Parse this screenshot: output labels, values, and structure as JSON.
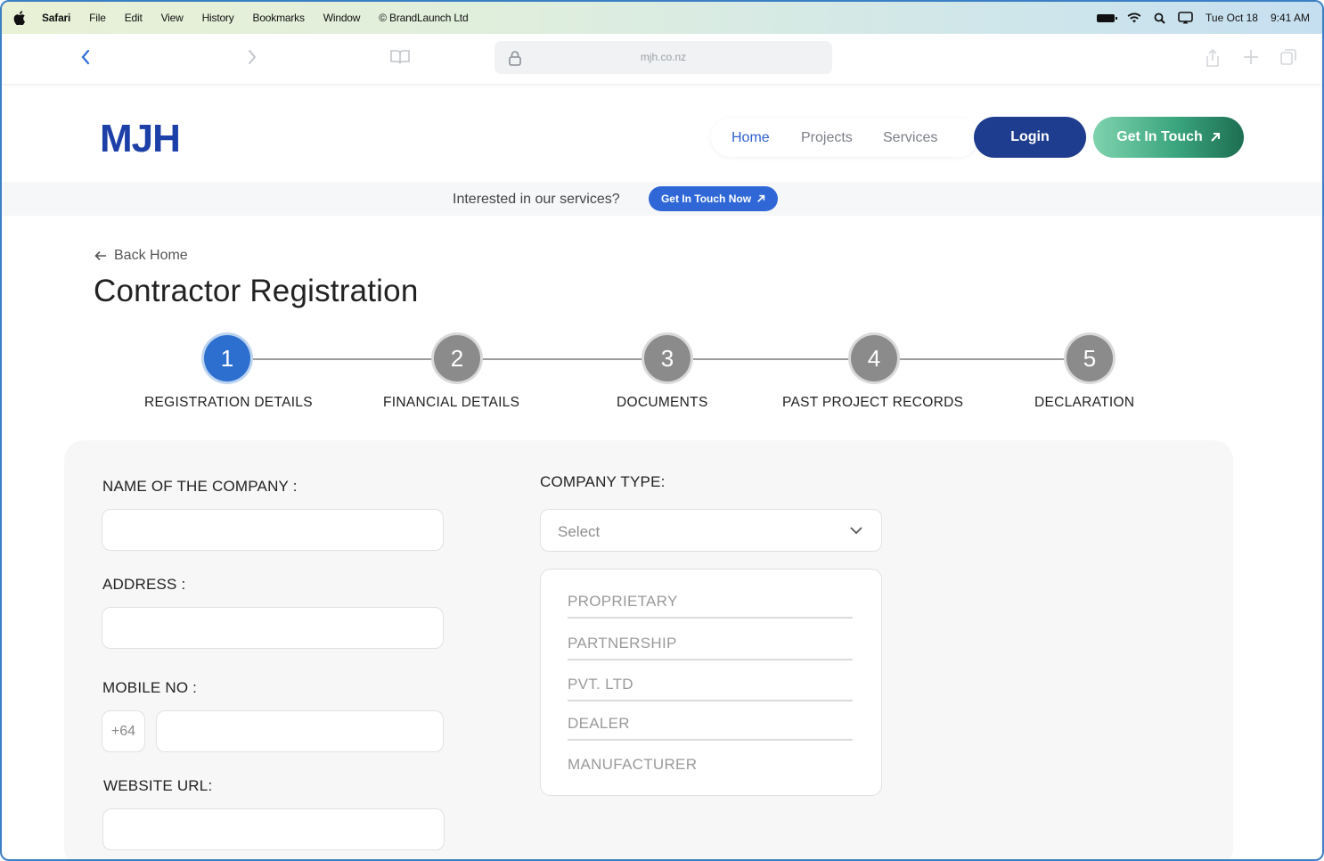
{
  "menubar": {
    "items": [
      "Safari",
      "File",
      "Edit",
      "View",
      "History",
      "Bookmarks",
      "Window",
      "© BrandLaunch Ltd"
    ],
    "date": "Tue Oct 18",
    "time": "9:41 AM"
  },
  "browser": {
    "url": "mjh.co.nz"
  },
  "header": {
    "logo_text": "MJH",
    "nav": [
      {
        "label": "Home",
        "active": true
      },
      {
        "label": "Projects",
        "active": false
      },
      {
        "label": "Services",
        "active": false
      }
    ],
    "login_label": "Login",
    "contact_label": "Get In Touch"
  },
  "banner": {
    "text": "Interested in our services?",
    "button_label": "Get In Touch Now"
  },
  "page": {
    "back_label": "Back Home",
    "title": "Contractor Registration"
  },
  "steps": [
    {
      "number": "1",
      "label": "REGISTRATION DETAILS",
      "active": true
    },
    {
      "number": "2",
      "label": "FINANCIAL DETAILS",
      "active": false
    },
    {
      "number": "3",
      "label": "DOCUMENTS",
      "active": false
    },
    {
      "number": "4",
      "label": "PAST PROJECT RECORDS",
      "active": false
    },
    {
      "number": "5",
      "label": "DECLARATION",
      "active": false
    }
  ],
  "form": {
    "company_name_label": "NAME OF THE COMPANY :",
    "company_name_value": "",
    "address_label": "ADDRESS :",
    "address_value": "",
    "mobile_label": "MOBILE NO :",
    "mobile_prefix": "+64",
    "mobile_value": "",
    "website_label": "WEBSITE URL:",
    "website_value": "",
    "company_type_label": "COMPANY TYPE:",
    "company_type_value": "Select",
    "company_type_options": [
      "PROPRIETARY",
      "PARTNERSHIP",
      "PVT. LTD",
      "DEALER",
      "MANUFACTURER"
    ]
  },
  "colors": {
    "primary_blue": "#2d6fcf",
    "login_navy": "#1f3d8e",
    "contact_green": "#3aa57e",
    "inactive_step": "#8b8b8b"
  }
}
